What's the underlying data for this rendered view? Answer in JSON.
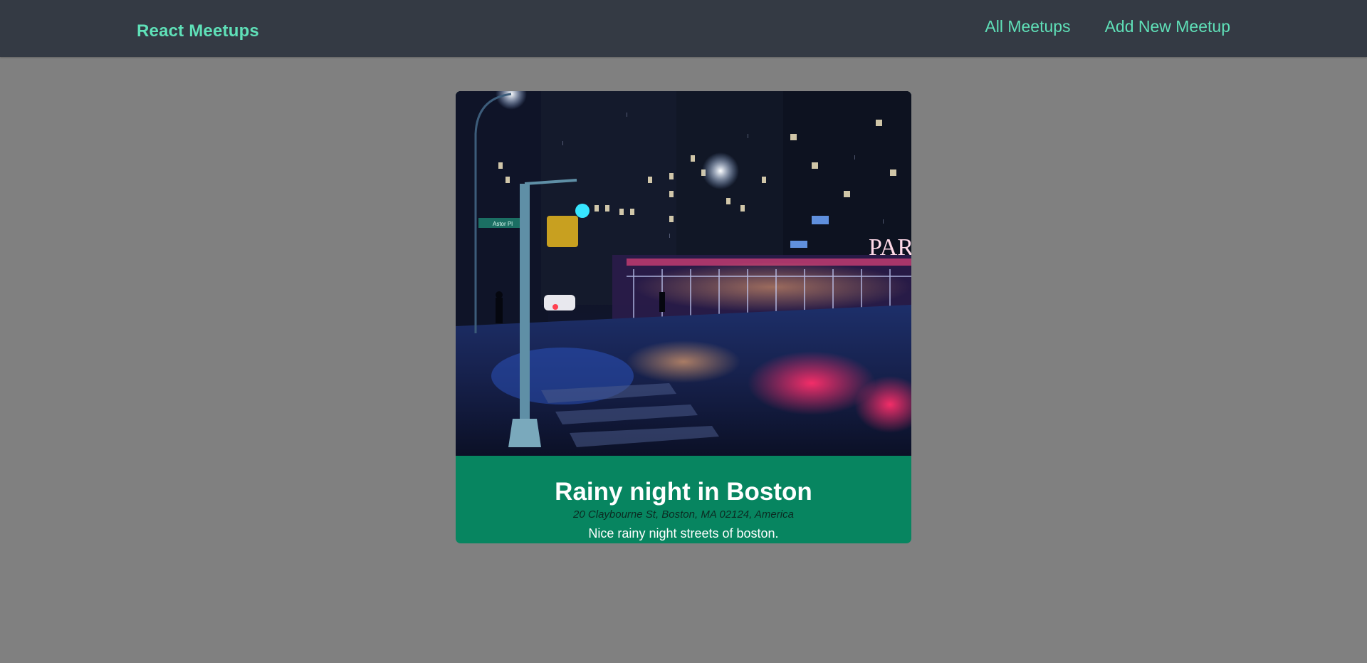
{
  "header": {
    "logo": "React Meetups",
    "nav": [
      {
        "label": "All Meetups"
      },
      {
        "label": "Add New Meetup"
      }
    ]
  },
  "meetup": {
    "title": "Rainy night in Boston",
    "address": "20 Claybourne St, Boston, MA 02124, America",
    "description": "Nice rainy night streets of boston.",
    "image_signs": {
      "street_sign": "Astor Pl",
      "storefront": "PAR"
    }
  },
  "colors": {
    "header_bg": "#343a44",
    "accent": "#5fe0b8",
    "page_bg": "#808080",
    "card_caption_bg": "#078560"
  }
}
